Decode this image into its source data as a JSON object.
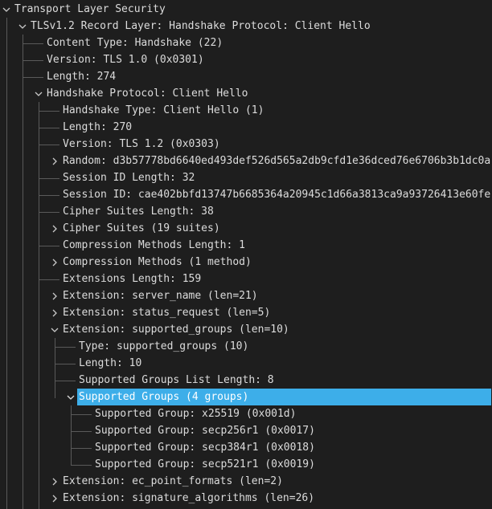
{
  "colors": {
    "background": "#1e1e1e",
    "text": "#dcdcdc",
    "selection": "#3daee9",
    "tree_lines": "#5a5a5a"
  },
  "tree": {
    "rows": [
      {
        "label": "Transport Layer Security",
        "depth": 0,
        "expander": "expanded",
        "name": "tree-node-transport-layer-security"
      },
      {
        "label": "TLSv1.2 Record Layer: Handshake Protocol: Client Hello",
        "depth": 1,
        "expander": "expanded",
        "name": "tree-node-tls-record-layer"
      },
      {
        "label": "Content Type: Handshake (22)",
        "depth": 2,
        "expander": "none",
        "name": "tree-node-content-type"
      },
      {
        "label": "Version: TLS 1.0 (0x0301)",
        "depth": 2,
        "expander": "none",
        "name": "tree-node-record-version"
      },
      {
        "label": "Length: 274",
        "depth": 2,
        "expander": "none",
        "name": "tree-node-record-length"
      },
      {
        "label": "Handshake Protocol: Client Hello",
        "depth": 2,
        "expander": "expanded",
        "name": "tree-node-handshake-protocol"
      },
      {
        "label": "Handshake Type: Client Hello (1)",
        "depth": 3,
        "expander": "none",
        "name": "tree-node-handshake-type"
      },
      {
        "label": "Length: 270",
        "depth": 3,
        "expander": "none",
        "name": "tree-node-handshake-length"
      },
      {
        "label": "Version: TLS 1.2 (0x0303)",
        "depth": 3,
        "expander": "none",
        "name": "tree-node-handshake-version"
      },
      {
        "label": "Random: d3b57778bd6640ed493def526d565a2db9cfd1e36dced76e6706b3b1dc0a",
        "depth": 3,
        "expander": "collapsed",
        "name": "tree-node-random"
      },
      {
        "label": "Session ID Length: 32",
        "depth": 3,
        "expander": "none",
        "name": "tree-node-session-id-length"
      },
      {
        "label": "Session ID: cae402bbfd13747b6685364a20945c1d66a3813ca9a93726413e60fe",
        "depth": 3,
        "expander": "none",
        "name": "tree-node-session-id"
      },
      {
        "label": "Cipher Suites Length: 38",
        "depth": 3,
        "expander": "none",
        "name": "tree-node-cipher-suites-length"
      },
      {
        "label": "Cipher Suites (19 suites)",
        "depth": 3,
        "expander": "collapsed",
        "name": "tree-node-cipher-suites"
      },
      {
        "label": "Compression Methods Length: 1",
        "depth": 3,
        "expander": "none",
        "name": "tree-node-compression-methods-length"
      },
      {
        "label": "Compression Methods (1 method)",
        "depth": 3,
        "expander": "collapsed",
        "name": "tree-node-compression-methods"
      },
      {
        "label": "Extensions Length: 159",
        "depth": 3,
        "expander": "none",
        "name": "tree-node-extensions-length"
      },
      {
        "label": "Extension: server_name (len=21)",
        "depth": 3,
        "expander": "collapsed",
        "name": "tree-node-ext-server-name"
      },
      {
        "label": "Extension: status_request (len=5)",
        "depth": 3,
        "expander": "collapsed",
        "name": "tree-node-ext-status-request"
      },
      {
        "label": "Extension: supported_groups (len=10)",
        "depth": 3,
        "expander": "expanded",
        "name": "tree-node-ext-supported-groups"
      },
      {
        "label": "Type: supported_groups (10)",
        "depth": 4,
        "expander": "none",
        "name": "tree-node-sg-type"
      },
      {
        "label": "Length: 10",
        "depth": 4,
        "expander": "none",
        "name": "tree-node-sg-length"
      },
      {
        "label": "Supported Groups List Length: 8",
        "depth": 4,
        "expander": "none",
        "name": "tree-node-sg-list-length"
      },
      {
        "label": "Supported Groups (4 groups)",
        "depth": 4,
        "expander": "expanded",
        "selected": true,
        "name": "tree-node-supported-groups"
      },
      {
        "label": "Supported Group: x25519 (0x001d)",
        "depth": 5,
        "expander": "none",
        "name": "tree-node-group-x25519"
      },
      {
        "label": "Supported Group: secp256r1 (0x0017)",
        "depth": 5,
        "expander": "none",
        "name": "tree-node-group-secp256r1"
      },
      {
        "label": "Supported Group: secp384r1 (0x0018)",
        "depth": 5,
        "expander": "none",
        "name": "tree-node-group-secp384r1"
      },
      {
        "label": "Supported Group: secp521r1 (0x0019)",
        "depth": 5,
        "expander": "none",
        "name": "tree-node-group-secp521r1"
      },
      {
        "label": "Extension: ec_point_formats (len=2)",
        "depth": 3,
        "expander": "collapsed",
        "name": "tree-node-ext-ec-point-formats"
      },
      {
        "label": "Extension: signature_algorithms (len=26)",
        "depth": 3,
        "expander": "collapsed",
        "name": "tree-node-ext-signature-algorithms"
      }
    ]
  }
}
